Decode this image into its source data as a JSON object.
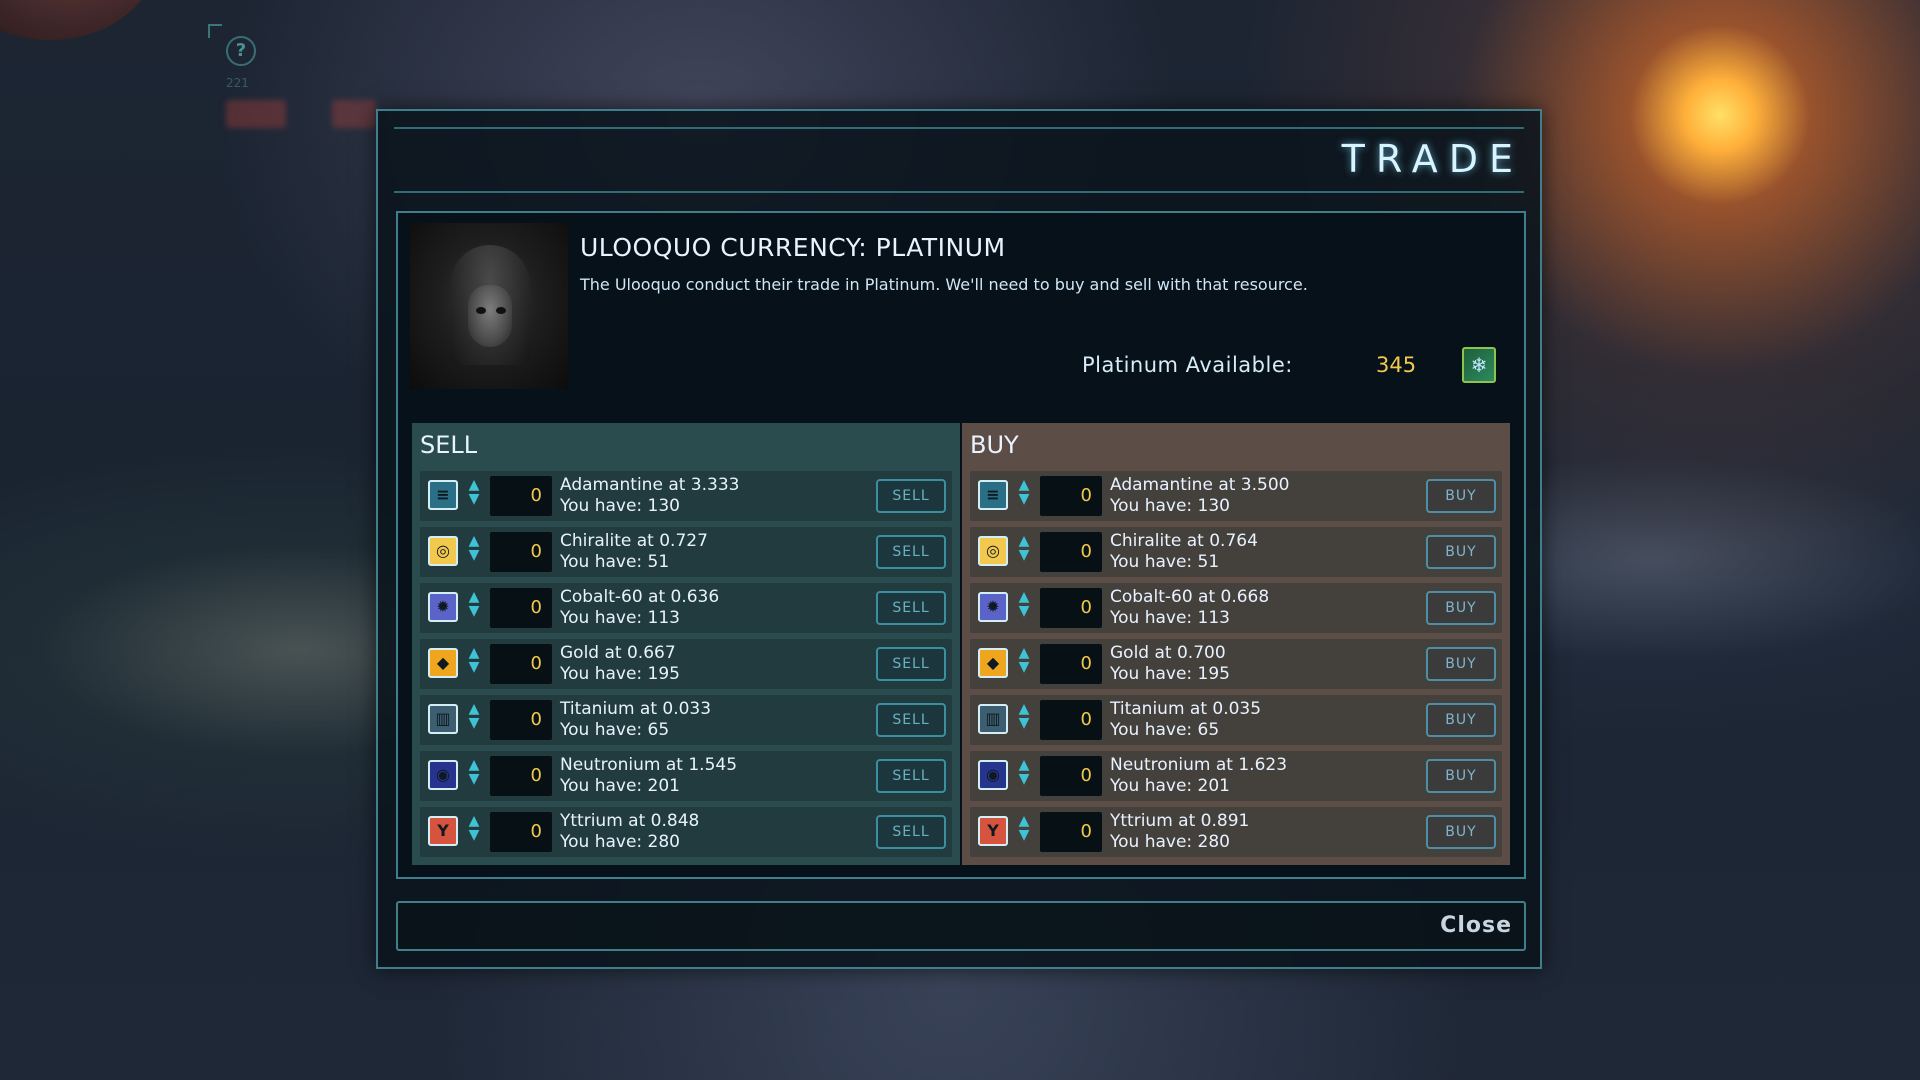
{
  "hud": {
    "help_label": "?",
    "counter": "221"
  },
  "dialog": {
    "title": "TRADE",
    "currency_title": "ULOOQUO CURRENCY: PLATINUM",
    "currency_desc": "The Ulooquo conduct their trade in Platinum. We'll need to buy and sell with that resource.",
    "available_label": "Platinum Available:",
    "available_value": "345",
    "available_icon": "platinum-crystal-icon",
    "close_label": "Close"
  },
  "sell": {
    "header": "SELL",
    "button_label": "SELL",
    "rows": [
      {
        "icon": "adamantine-icon",
        "glyph": "≡",
        "color": "#2a6f86",
        "qty": "0",
        "line1": "Adamantine at 3.333",
        "line2": "You have: 130"
      },
      {
        "icon": "chiralite-icon",
        "glyph": "◎",
        "color": "#f2c94c",
        "qty": "0",
        "line1": "Chiralite at 0.727",
        "line2": "You have: 51"
      },
      {
        "icon": "cobalt-60-icon",
        "glyph": "✹",
        "color": "#5b63c9",
        "qty": "0",
        "line1": "Cobalt-60 at 0.636",
        "line2": "You have: 113"
      },
      {
        "icon": "gold-icon",
        "glyph": "◆",
        "color": "#f0a51e",
        "qty": "0",
        "line1": "Gold at 0.667",
        "line2": "You have: 195"
      },
      {
        "icon": "titanium-icon",
        "glyph": "▥",
        "color": "#3c5e70",
        "qty": "0",
        "line1": "Titanium at 0.033",
        "line2": "You have: 65"
      },
      {
        "icon": "neutronium-icon",
        "glyph": "◉",
        "color": "#27348e",
        "qty": "0",
        "line1": "Neutronium at 1.545",
        "line2": "You have: 201"
      },
      {
        "icon": "yttrium-icon",
        "glyph": "Y",
        "color": "#d6533e",
        "qty": "0",
        "line1": "Yttrium at 0.848",
        "line2": "You have: 280"
      }
    ]
  },
  "buy": {
    "header": "BUY",
    "button_label": "BUY",
    "rows": [
      {
        "icon": "adamantine-icon",
        "glyph": "≡",
        "color": "#2a6f86",
        "qty": "0",
        "line1": "Adamantine at 3.500",
        "line2": "You have: 130"
      },
      {
        "icon": "chiralite-icon",
        "glyph": "◎",
        "color": "#f2c94c",
        "qty": "0",
        "line1": "Chiralite at 0.764",
        "line2": "You have: 51"
      },
      {
        "icon": "cobalt-60-icon",
        "glyph": "✹",
        "color": "#5b63c9",
        "qty": "0",
        "line1": "Cobalt-60 at 0.668",
        "line2": "You have: 113"
      },
      {
        "icon": "gold-icon",
        "glyph": "◆",
        "color": "#f0a51e",
        "qty": "0",
        "line1": "Gold at 0.700",
        "line2": "You have: 195"
      },
      {
        "icon": "titanium-icon",
        "glyph": "▥",
        "color": "#3c5e70",
        "qty": "0",
        "line1": "Titanium at 0.035",
        "line2": "You have: 65"
      },
      {
        "icon": "neutronium-icon",
        "glyph": "◉",
        "color": "#27348e",
        "qty": "0",
        "line1": "Neutronium at 1.623",
        "line2": "You have: 201"
      },
      {
        "icon": "yttrium-icon",
        "glyph": "Y",
        "color": "#d6533e",
        "qty": "0",
        "line1": "Yttrium at 0.891",
        "line2": "You have: 280"
      }
    ]
  }
}
